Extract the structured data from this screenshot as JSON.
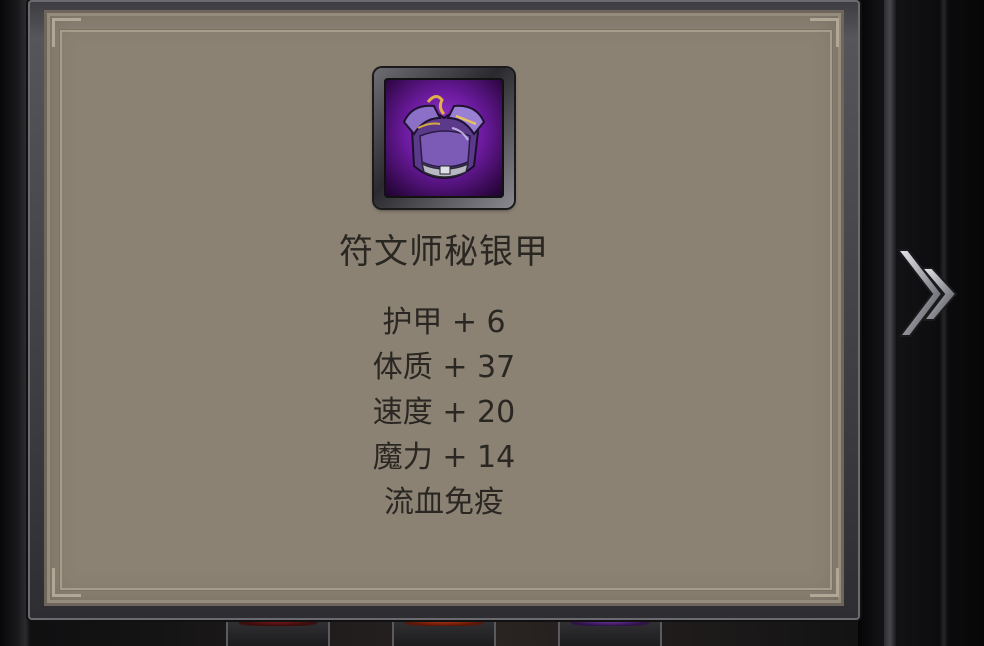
{
  "item": {
    "name": "符文师秘银甲",
    "icon": "purple-chest-armor-icon",
    "rarity_color": "#7b22b4"
  },
  "stats": [
    {
      "text": "护甲 + 6"
    },
    {
      "text": "体质 + 37"
    },
    {
      "text": "速度 + 20"
    },
    {
      "text": "魔力 + 14"
    },
    {
      "text": "流血免疫"
    }
  ],
  "navigation": {
    "next_icon": "double-chevron-right-icon"
  },
  "colors": {
    "card_background": "#8b8274",
    "text": "#2a2622",
    "frame": "#3c3c40"
  }
}
